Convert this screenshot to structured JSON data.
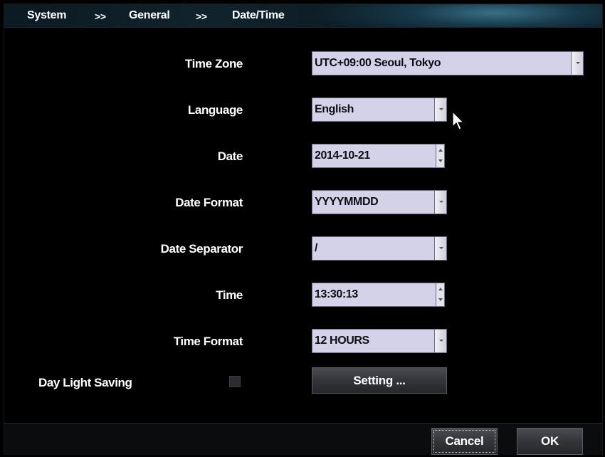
{
  "breadcrumb": {
    "items": [
      "System",
      "General",
      "Date/Time"
    ],
    "separator": ">>"
  },
  "fields": {
    "time_zone": {
      "label": "Time Zone",
      "value": "UTC+09:00 Seoul, Tokyo"
    },
    "language": {
      "label": "Language",
      "value": "English"
    },
    "date": {
      "label": "Date",
      "value": "2014-10-21"
    },
    "date_format": {
      "label": "Date Format",
      "value": "YYYYMMDD"
    },
    "date_separator": {
      "label": "Date Separator",
      "value": "/"
    },
    "time": {
      "label": "Time",
      "value": "13:30:13"
    },
    "time_format": {
      "label": "Time Format",
      "value": "12 HOURS"
    }
  },
  "day_light_saving": {
    "label": "Day Light Saving",
    "checked": false,
    "setting_button": "Setting ..."
  },
  "footer": {
    "cancel_label": "Cancel",
    "ok_label": "OK"
  },
  "icons": {
    "dropdown": "chevron-down-icon",
    "spinner": "spinner-arrows-icon",
    "cursor": "mouse-pointer-icon"
  },
  "colors": {
    "field_bg": "#d3d2e9",
    "background": "#000000",
    "header_accent": "#3a6f86"
  }
}
